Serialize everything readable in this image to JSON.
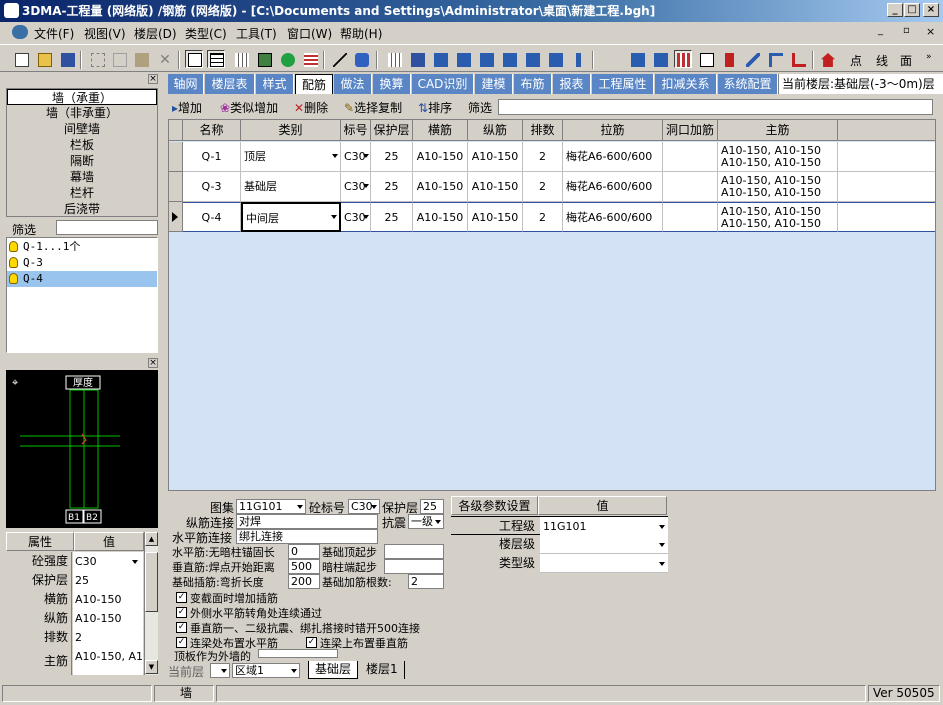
{
  "window": {
    "title": "3DMA-工程量 (网络版) /钢筋 (网络版) - [C:\\Documents and Settings\\Administrator\\桌面\\新建工程.bgh]"
  },
  "menu": [
    "文件(F)",
    "视图(V)",
    "楼层(D)",
    "类型(C)",
    "工具(T)",
    "窗口(W)",
    "帮助(H)"
  ],
  "toolbar_text": [
    "点",
    "线",
    "面"
  ],
  "categories": [
    "墙（承重）",
    "墙（非承重）",
    "间壁墙",
    "栏板",
    "隔断",
    "幕墙",
    "栏杆",
    "后浇带"
  ],
  "filter_label": "筛选",
  "tree": [
    "Q-1...1个",
    "Q-3",
    "Q-4"
  ],
  "preview": {
    "thickness_label": "厚度",
    "b1": "B1",
    "b2": "B2"
  },
  "props": {
    "header_attr": "属性",
    "header_val": "值",
    "rows": [
      {
        "k": "砼强度",
        "v": "C30"
      },
      {
        "k": "保护层",
        "v": "25"
      },
      {
        "k": "横筋",
        "v": "A10-150"
      },
      {
        "k": "纵筋",
        "v": "A10-150"
      },
      {
        "k": "排数",
        "v": "2"
      },
      {
        "k": "主筋",
        "v": "A10-150, A1"
      }
    ]
  },
  "tabs": [
    "轴网",
    "楼层表",
    "样式",
    "配筋",
    "做法",
    "换算",
    "CAD识别",
    "建模",
    "布筋",
    "报表",
    "工程属性",
    "扣减关系",
    "系统配置"
  ],
  "active_tab": "配筋",
  "current_floor": "当前楼层:基础层(-3～0m)层",
  "subtoolbar": {
    "add": "增加",
    "similar": "类似增加",
    "delete": "删除",
    "copy": "选择复制",
    "sort": "排序",
    "filter": "筛选"
  },
  "grid": {
    "columns": [
      "名称",
      "类别",
      "标号",
      "保护层",
      "横筋",
      "纵筋",
      "排数",
      "拉筋",
      "洞口加筋",
      "主筋"
    ],
    "rows": [
      {
        "name": "Q-1",
        "type": "顶层",
        "grade": "C30",
        "cover": "25",
        "h": "A10-150",
        "v": "A10-150",
        "rows": "2",
        "tie": "梅花A6-600/600",
        "opening": "",
        "main1": "A10-150, A10-150",
        "main2": "A10-150, A10-150"
      },
      {
        "name": "Q-3",
        "type": "基础层",
        "grade": "C30",
        "cover": "25",
        "h": "A10-150",
        "v": "A10-150",
        "rows": "2",
        "tie": "梅花A6-600/600",
        "opening": "",
        "main1": "A10-150, A10-150",
        "main2": "A10-150, A10-150"
      },
      {
        "name": "Q-4",
        "type": "中间层",
        "grade": "C30",
        "cover": "25",
        "h": "A10-150",
        "v": "A10-150",
        "rows": "2",
        "tie": "梅花A6-600/600",
        "opening": "",
        "main1": "A10-150, A10-150",
        "main2": "A10-150, A10-150"
      }
    ]
  },
  "settings": {
    "atlas_label": "图集",
    "atlas_val": "11G101",
    "grade_label": "砼标号",
    "grade_val": "C30",
    "cover_label": "保护层",
    "cover_val": "25",
    "vconn_label": "纵筋连接",
    "vconn_val": "对焊",
    "seismic_label": "抗震",
    "seismic_val": "一级",
    "hconn_label": "水平筋连接",
    "hconn_val": "绑扎连接",
    "anchor_label": "水平筋:无暗柱锚固长",
    "anchor_val": "0",
    "base_top_label": "基础顶起步",
    "weld_label": "垂直筋:焊点开始距离",
    "weld_val": "500",
    "col_end_label": "暗柱端起步",
    "dowel_label": "基础插筋:弯折长度",
    "dowel_val": "200",
    "dowel_count_label": "基础加筋根数:",
    "dowel_count_val": "2",
    "checks": [
      "变截面时增加插筋",
      "外侧水平筋转角处连续通过",
      "垂直筋一、二级抗震、绑扎搭接时错开500连接",
      "连梁处布置水平筋",
      "连梁上布置垂直筋"
    ],
    "roof_label": "顶板作为外墙的"
  },
  "levels": {
    "header_k": "各级参数设置",
    "header_v": "值",
    "rows": [
      {
        "k": "工程级",
        "v": "11G101"
      },
      {
        "k": "楼层级",
        "v": ""
      },
      {
        "k": "类型级",
        "v": ""
      }
    ]
  },
  "floorbar": {
    "label": "当前层",
    "region": "区域1",
    "tab1": "基础层",
    "tab2": "楼层1"
  },
  "status": {
    "item": "墙",
    "version": "Ver 50505"
  }
}
